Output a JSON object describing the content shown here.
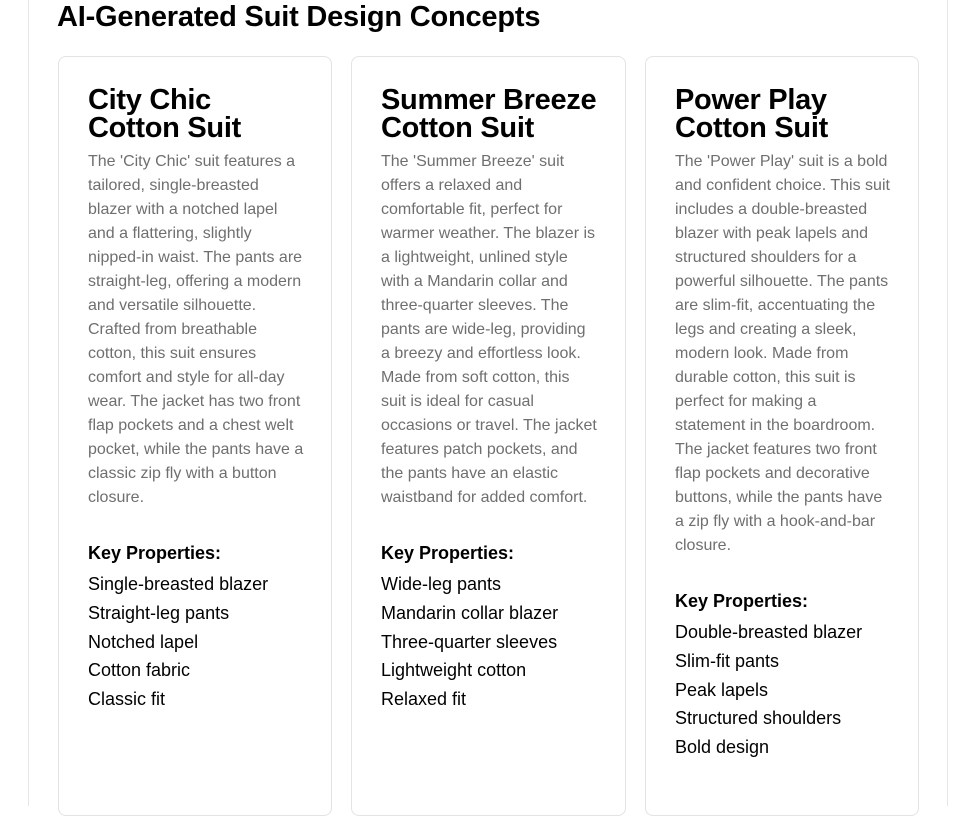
{
  "page": {
    "title": "AI-Generated Suit Design Concepts"
  },
  "key_properties_label": "Key Properties:",
  "cards": [
    {
      "title": "City Chic Cotton Suit",
      "description": "The 'City Chic' suit features a tailored, single-breasted blazer with a notched lapel and a flattering, slightly nipped-in waist. The pants are straight-leg, offering a modern and versatile silhouette. Crafted from breathable cotton, this suit ensures comfort and style for all-day wear. The jacket has two front flap pockets and a chest welt pocket, while the pants have a classic zip fly with a button closure.",
      "properties": [
        "Single-breasted blazer",
        "Straight-leg pants",
        "Notched lapel",
        "Cotton fabric",
        "Classic fit"
      ]
    },
    {
      "title": "Summer Breeze Cotton Suit",
      "description": "The 'Summer Breeze' suit offers a relaxed and comfortable fit, perfect for warmer weather. The blazer is a lightweight, unlined style with a Mandarin collar and three-quarter sleeves. The pants are wide-leg, providing a breezy and effortless look. Made from soft cotton, this suit is ideal for casual occasions or travel. The jacket features patch pockets, and the pants have an elastic waistband for added comfort.",
      "properties": [
        "Wide-leg pants",
        "Mandarin collar blazer",
        "Three-quarter sleeves",
        "Lightweight cotton",
        "Relaxed fit"
      ]
    },
    {
      "title": "Power Play Cotton Suit",
      "description": "The 'Power Play' suit is a bold and confident choice. This suit includes a double-breasted blazer with peak lapels and structured shoulders for a powerful silhouette. The pants are slim-fit, accentuating the legs and creating a sleek, modern look. Made from durable cotton, this suit is perfect for making a statement in the boardroom. The jacket features two front flap pockets and decorative buttons, while the pants have a zip fly with a hook-and-bar closure.",
      "properties": [
        "Double-breasted blazer",
        "Slim-fit pants",
        "Peak lapels",
        "Structured shoulders",
        "Bold design"
      ]
    }
  ]
}
